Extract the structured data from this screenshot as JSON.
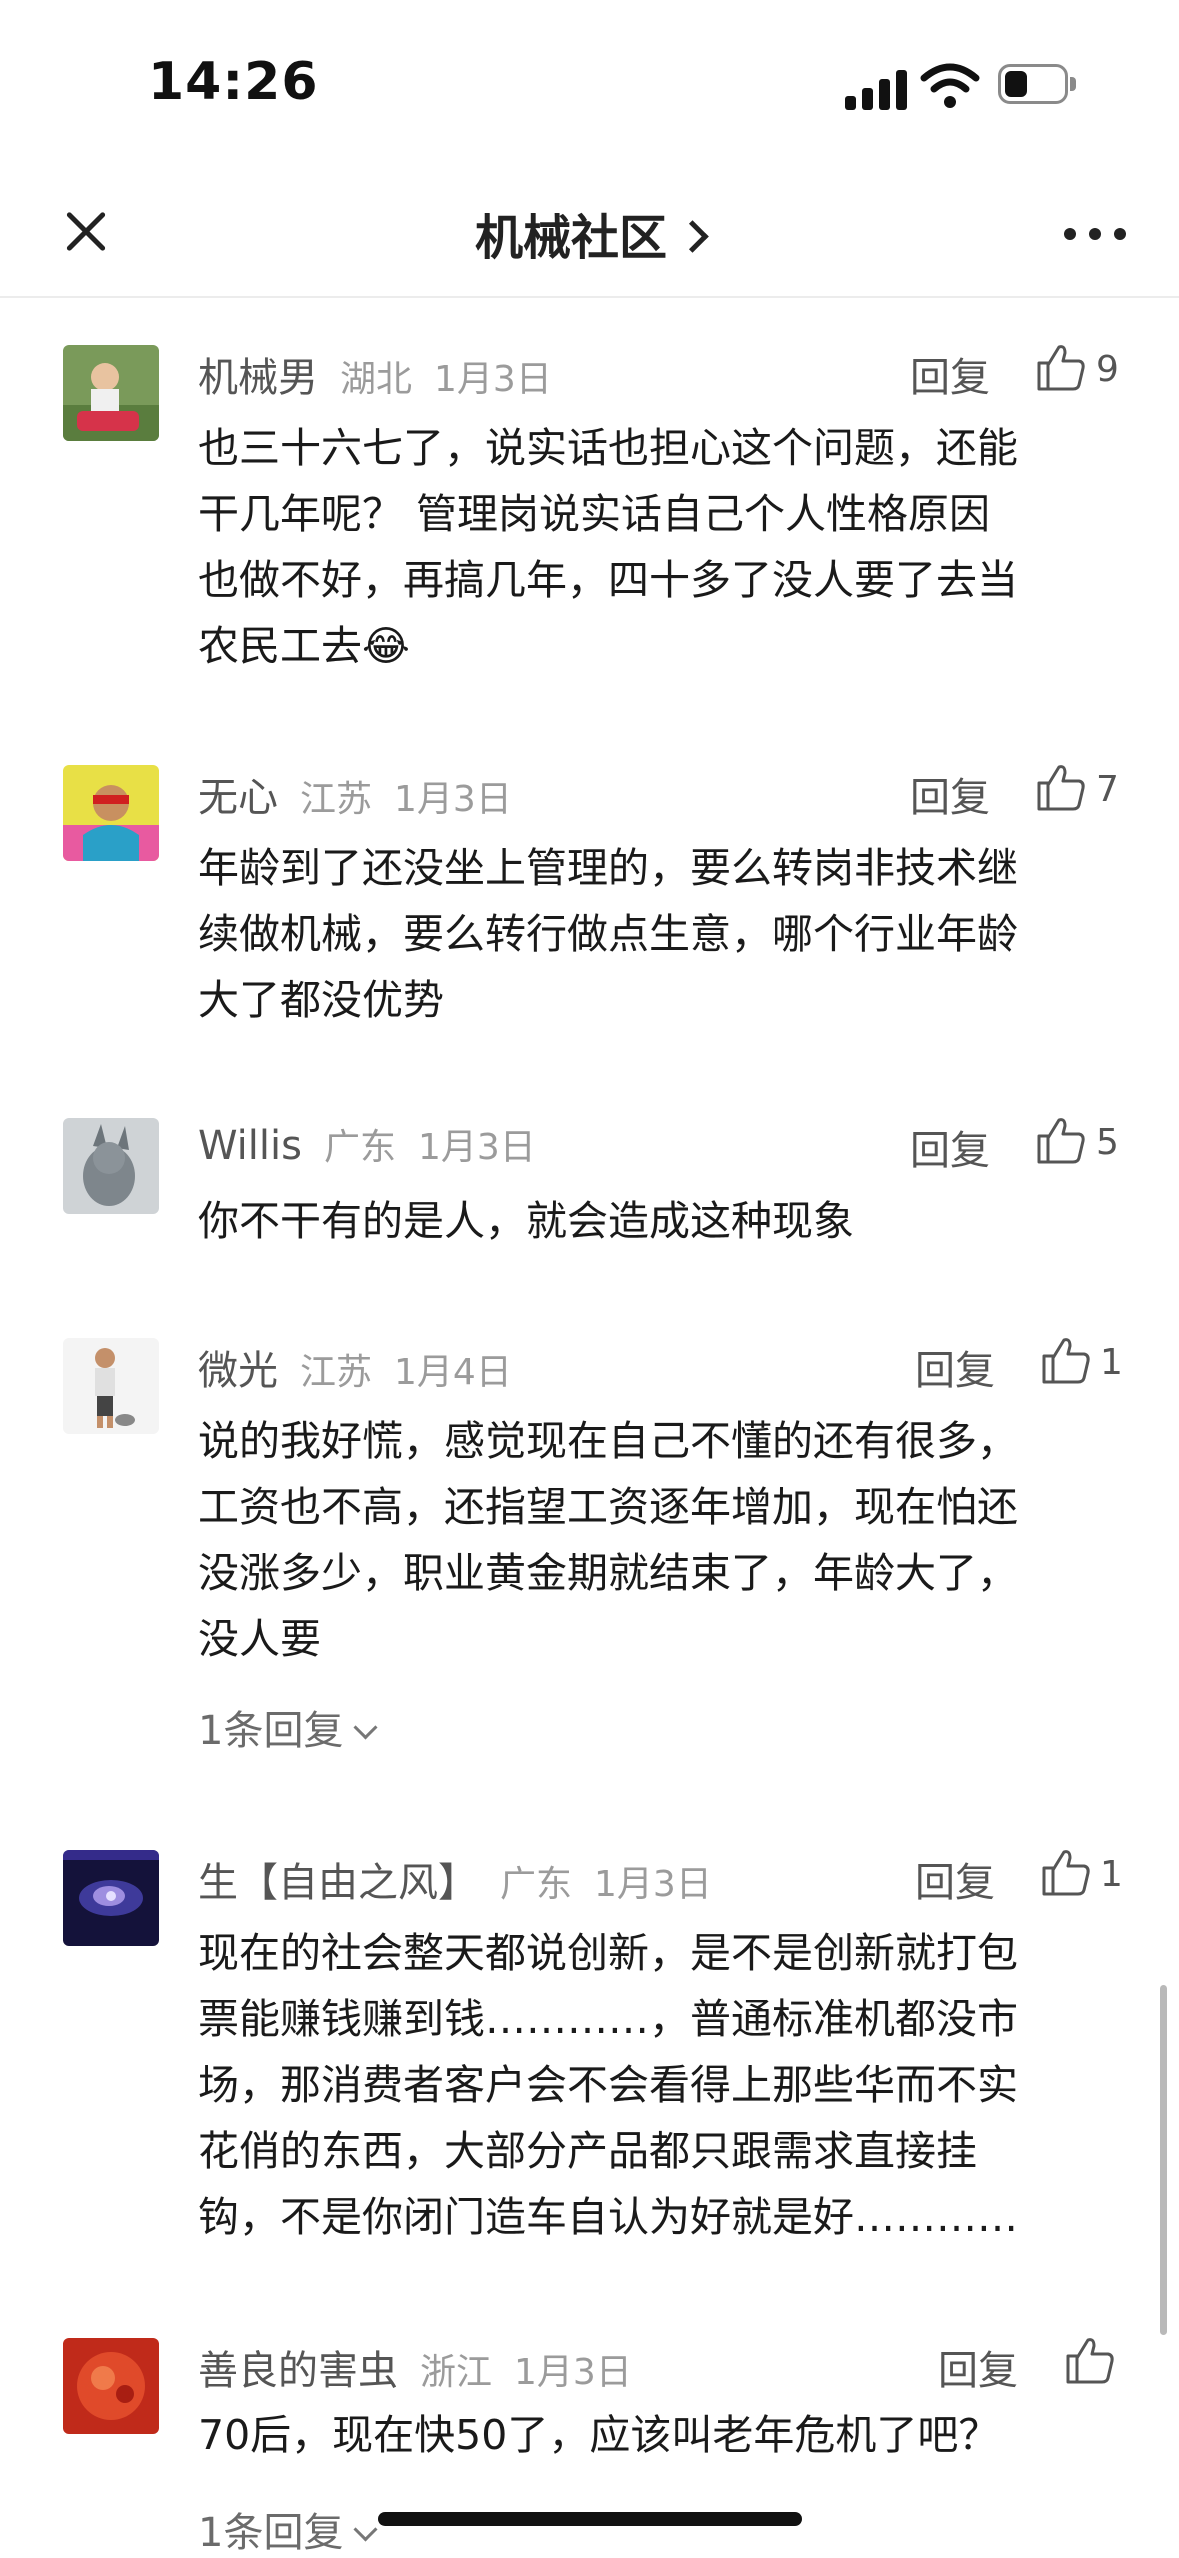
{
  "status": {
    "time": "14:26"
  },
  "nav": {
    "title": "机械社区"
  },
  "reply_label": "回复",
  "comments": [
    {
      "name": "机械男",
      "region": "湖北",
      "date": "1月3日",
      "likes": "9",
      "lines": [
        "也三十六七了，说实话也担心这个问题，还能",
        "干几年呢？ 管理岗说实话自己个人性格原因",
        "也做不好，再搞几年，四十多了没人要了去当",
        "农民工去😂"
      ]
    },
    {
      "name": "无心",
      "region": "江苏",
      "date": "1月3日",
      "likes": "7",
      "lines": [
        "年龄到了还没坐上管理的，要么转岗非技术继",
        "续做机械，要么转行做点生意，哪个行业年龄",
        "大了都没优势"
      ]
    },
    {
      "name": "Willis",
      "region": "广东",
      "date": "1月3日",
      "likes": "5",
      "lines": [
        "你不干有的是人，就会造成这种现象"
      ]
    },
    {
      "name": "微光",
      "region": "江苏",
      "date": "1月4日",
      "likes": "1",
      "lines": [
        "说的我好慌，感觉现在自己不懂的还有很多，",
        "工资也不高，还指望工资逐年增加，现在怕还",
        "没涨多少，职业黄金期就结束了，年龄大了，",
        "没人要"
      ],
      "more_replies": "1条回复"
    },
    {
      "name": "生【自由之风】",
      "region": "广东",
      "date": "1月3日",
      "likes": "1",
      "lines": [
        "现在的社会整天都说创新，是不是创新就打包",
        "票能赚钱赚到钱…………，普通标准机都没市",
        "场，那消费者客户会不会看得上那些华而不实",
        "花俏的东西，大部分产品都只跟需求直接挂",
        "钩，不是你闭门造车自认为好就是好…………"
      ]
    },
    {
      "name": "善良的害虫",
      "region": "浙江",
      "date": "1月3日",
      "likes": "",
      "lines": [
        "70后，现在快50了，应该叫老年危机了吧？"
      ],
      "more_replies": "1条回复"
    }
  ]
}
